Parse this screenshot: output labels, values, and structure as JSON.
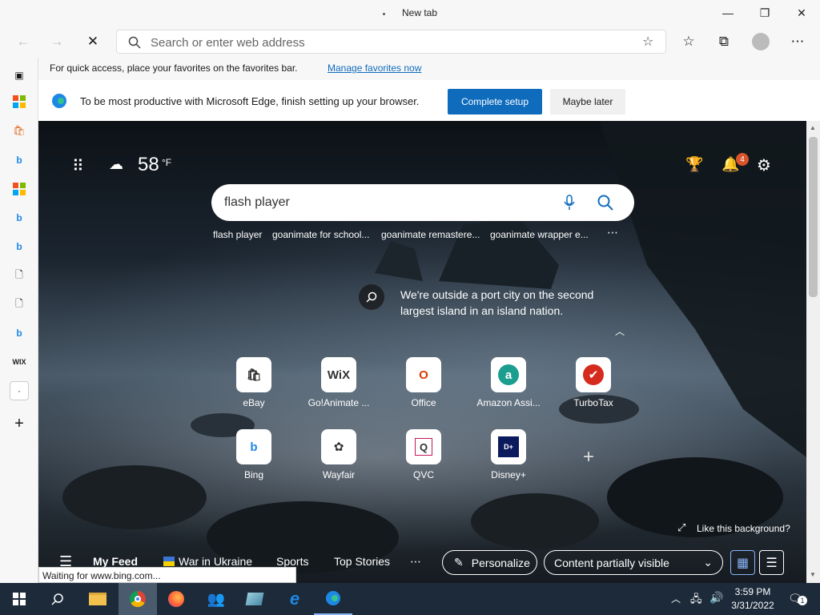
{
  "tab": {
    "title": "New tab"
  },
  "address": {
    "placeholder": "Search or enter web address"
  },
  "favbar": {
    "text": "For quick access, place your favorites on the favorites bar.",
    "link": "Manage favorites now"
  },
  "setup": {
    "message": "To be most productive with Microsoft Edge, finish setting up your browser.",
    "complete": "Complete setup",
    "later": "Maybe later"
  },
  "weather": {
    "temp": "58",
    "unit": "°F"
  },
  "notifications": {
    "count": "4"
  },
  "search": {
    "value": "flash player",
    "suggestions": [
      "flash player",
      "goanimate for school...",
      "goanimate remastere...",
      "goanimate wrapper e..."
    ]
  },
  "caption": "We're outside a port city on the second largest island in an island nation.",
  "tiles": [
    {
      "label": "eBay",
      "icon": "ebay-bag-icon",
      "glyph": "🛍"
    },
    {
      "label": "Go!Animate ...",
      "icon": "wix-logo",
      "glyph": "WiX"
    },
    {
      "label": "Office",
      "icon": "office-icon",
      "glyph": "O"
    },
    {
      "label": "Amazon Assi...",
      "icon": "amazon-icon",
      "glyph": "a"
    },
    {
      "label": "TurboTax",
      "icon": "turbotax-icon",
      "glyph": "✔"
    },
    {
      "label": "Bing",
      "icon": "bing-icon",
      "glyph": "b"
    },
    {
      "label": "Wayfair",
      "icon": "wayfair-icon",
      "glyph": "✿"
    },
    {
      "label": "QVC",
      "icon": "qvc-icon",
      "glyph": "Q"
    },
    {
      "label": "Disney+",
      "icon": "disney-icon",
      "glyph": "D+"
    }
  ],
  "like_bg": "Like this background?",
  "feed": {
    "my": "My Feed",
    "ukraine": "War in Ukraine",
    "sports": "Sports",
    "top": "Top Stories",
    "personalize": "Personalize",
    "visibility": "Content partially visible"
  },
  "status": "Waiting for www.bing.com...",
  "clock": {
    "time": "3:59 PM",
    "date": "3/31/2022"
  },
  "tray": {
    "notif_count": "1"
  },
  "colors": {
    "accent": "#0f6cbd",
    "taskbar": "#1c2a3a"
  }
}
